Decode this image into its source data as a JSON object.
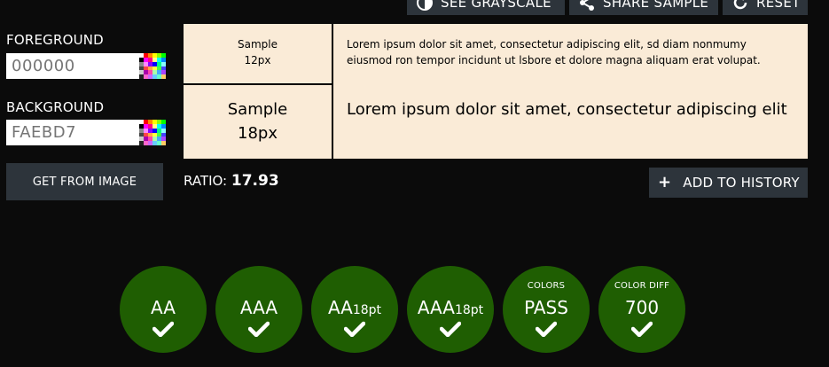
{
  "toolbar": {
    "see_grayscale_label": "SEE GRAYSCALE",
    "share_sample_label": "SHARE SAMPLE",
    "reset_label": "RESET"
  },
  "foreground": {
    "label": "FOREGROUND",
    "placeholder": "000000",
    "value": ""
  },
  "background": {
    "label": "BACKGROUND",
    "placeholder": "FAEBD7",
    "value": ""
  },
  "get_from_image_label": "GET FROM IMAGE",
  "preview": {
    "foreground_color": "#000000",
    "background_color": "#FAEBD7",
    "small": {
      "sample_word": "Sample",
      "size": "12px",
      "lorem": "Lorem ipsum dolor sit amet, consectetur adipiscing elit, sd diam nonmumy eiusmod ron tempor incidunt ut lsbore et dolore magna aliquam erat volupat."
    },
    "large": {
      "sample_word": "Sample",
      "size": "18px",
      "lorem": "Lorem ipsum dolor sit amet, consectetur adipiscing elit"
    }
  },
  "ratio": {
    "label": "RATIO:",
    "value": "17.93"
  },
  "add_to_history_label": "ADD TO HISTORY",
  "results": {
    "pass_color": "#1F5E02",
    "badges": [
      {
        "caption": "",
        "main": "AA",
        "sub": "",
        "status": "pass"
      },
      {
        "caption": "",
        "main": "AAA",
        "sub": "",
        "status": "pass"
      },
      {
        "caption": "",
        "main": "AA",
        "sub": "18pt",
        "status": "pass"
      },
      {
        "caption": "",
        "main": "AAA",
        "sub": "18pt",
        "status": "pass"
      },
      {
        "caption": "COLORS",
        "main": "PASS",
        "sub": "",
        "status": "pass"
      },
      {
        "caption": "COLOR DIFF",
        "main": "700",
        "sub": "",
        "status": "pass"
      }
    ]
  },
  "icons": {
    "grayscale": "half-circle-icon",
    "share": "share-icon",
    "reset": "refresh-icon",
    "add": "plus-icon",
    "check": "checkmark-icon",
    "picker": "color-palette-icon"
  }
}
